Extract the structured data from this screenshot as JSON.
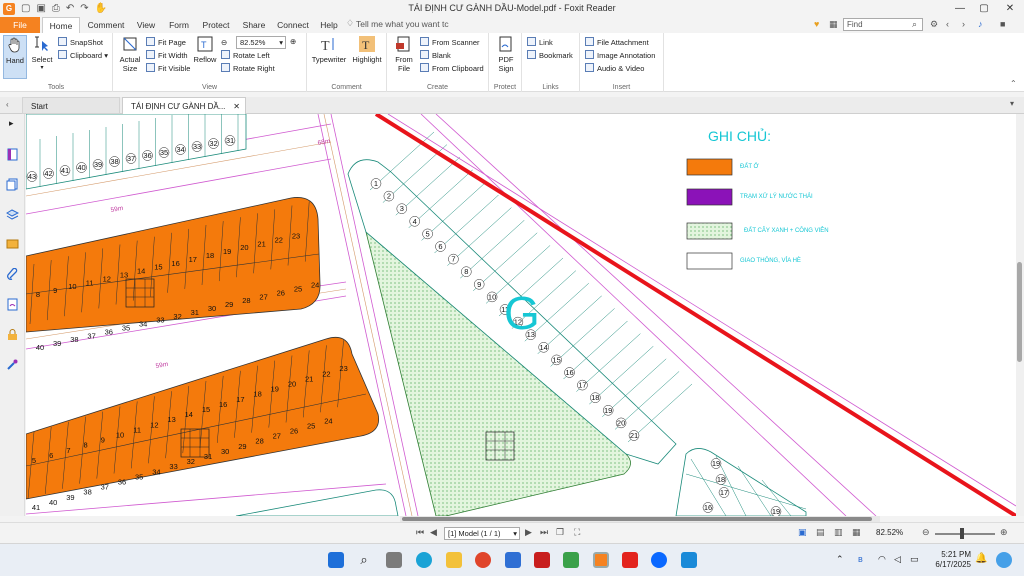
{
  "window": {
    "title": "TÁI ĐỊNH CƯ GÀNH DẦU-Model.pdf - Foxit Reader",
    "app_icon": "G"
  },
  "ribbon_tabs": [
    "File",
    "Home",
    "Comment",
    "View",
    "Form",
    "Protect",
    "Share",
    "Connect",
    "Help"
  ],
  "tell_me": "Tell me what you want tc",
  "find_placeholder": "Find",
  "groups": {
    "tools": {
      "label": "Tools",
      "hand": "Hand",
      "select": "Select",
      "snapshot": "SnapShot",
      "clipboard": "Clipboard"
    },
    "view": {
      "label": "View",
      "actual_size": "Actual Size",
      "fit_page": "Fit Page",
      "fit_width": "Fit Width",
      "fit_visible": "Fit Visible",
      "reflow": "Reflow",
      "zoom": "82.52%",
      "rotate_left": "Rotate Left",
      "rotate_right": "Rotate Right"
    },
    "comment": {
      "label": "Comment",
      "typewriter": "Typewriter",
      "highlight": "Highlight"
    },
    "create": {
      "label": "Create",
      "from_file": "From File",
      "from_scanner": "From Scanner",
      "blank": "Blank",
      "from_clipboard": "From Clipboard"
    },
    "protect": {
      "label": "Protect",
      "pdf_sign": "PDF Sign"
    },
    "links": {
      "label": "Links",
      "link": "Link",
      "bookmark": "Bookmark"
    },
    "insert": {
      "label": "Insert",
      "file_attachment": "File Attachment",
      "image_annotation": "Image Annotation",
      "audio_video": "Audio & Video"
    }
  },
  "doc_tabs": {
    "start": "Start",
    "document": "TÁI ĐỊNH CƯ GÀNH DẦ..."
  },
  "map": {
    "legend": {
      "title": "GHI CHỦ:",
      "items": [
        {
          "label": "ĐẤT Ở",
          "color": "#f47a0c"
        },
        {
          "label": "TRẠM XỬ LÝ NƯỚC THẢI",
          "color": "#8b12b8"
        },
        {
          "label": "ĐẤT CÂY XANH + CÔNG VIÊN",
          "color": "#d9f2d3"
        },
        {
          "label": "GIAO THÔNG, VỈA HÈ",
          "color": "#ffffff"
        }
      ]
    },
    "zone_label": "G",
    "lots_top_strip": [
      "43",
      "42",
      "41",
      "40",
      "39",
      "38",
      "37",
      "36",
      "35",
      "34",
      "33",
      "32",
      "31"
    ],
    "block1_top": [
      "8",
      "9",
      "10",
      "11",
      "12",
      "13",
      "14",
      "15",
      "16",
      "17",
      "18",
      "19",
      "20",
      "21",
      "22",
      "23"
    ],
    "block1_bottom": [
      "40",
      "39",
      "38",
      "37",
      "36",
      "35",
      "34",
      "33",
      "32",
      "31",
      "30",
      "29",
      "28",
      "27",
      "26",
      "25",
      "24"
    ],
    "block2_top": [
      "5",
      "6",
      "7",
      "8",
      "9",
      "10",
      "11",
      "12",
      "13",
      "14",
      "15",
      "16",
      "17",
      "18",
      "19",
      "20",
      "21",
      "22",
      "23"
    ],
    "block2_bottom": [
      "41",
      "40",
      "39",
      "38",
      "37",
      "36",
      "35",
      "34",
      "33",
      "32",
      "31",
      "30",
      "29",
      "28",
      "27",
      "26",
      "25",
      "24"
    ],
    "block_g_lots": [
      "1",
      "2",
      "3",
      "4",
      "5",
      "6",
      "7",
      "8",
      "9",
      "10",
      "11",
      "12",
      "13",
      "14",
      "15",
      "16",
      "17",
      "18",
      "19",
      "20",
      "21"
    ],
    "block_br_lots": [
      "19",
      "18",
      "17",
      "16",
      "19"
    ],
    "road_labels": [
      "59m",
      "59m",
      "68m"
    ]
  },
  "status": {
    "page": "[1] Model (1 / 1)",
    "zoom": "82.52%"
  },
  "taskbar": {
    "time": "5:21 PM",
    "date": "6/17/2025"
  }
}
